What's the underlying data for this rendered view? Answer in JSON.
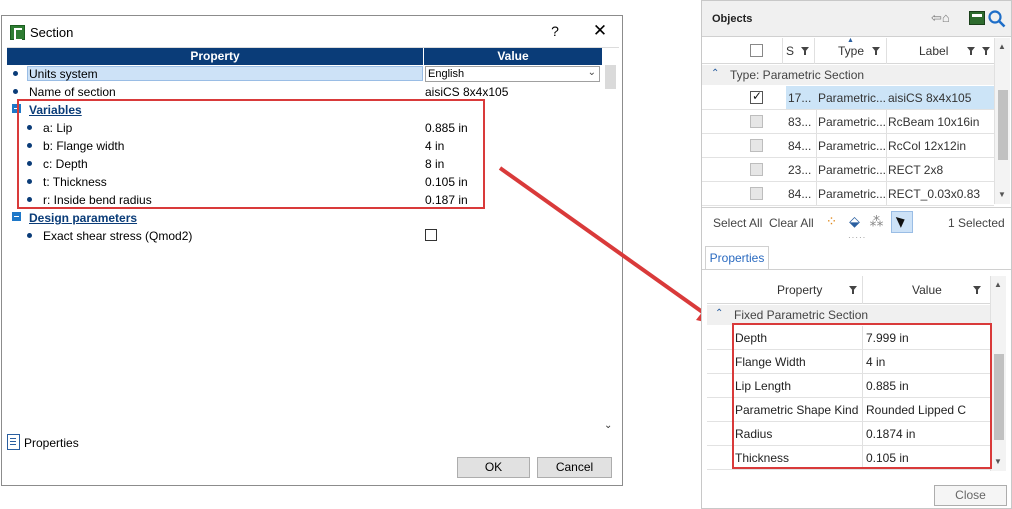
{
  "dialog": {
    "title": "Section",
    "help_glyph": "?",
    "close_glyph": "✕",
    "header_property": "Property",
    "header_value": "Value",
    "rows": {
      "units_name": "Units system",
      "units_value": "English",
      "section_name": "Name of section",
      "section_value": "aisiCS 8x4x105",
      "variables_group": "Variables",
      "lip_name": "a: Lip",
      "lip_value": "0.885 in",
      "flange_name": "b: Flange width",
      "flange_value": "4 in",
      "depth_name": "c: Depth",
      "depth_value": "8 in",
      "thickness_name": "t: Thickness",
      "thickness_value": "0.105 in",
      "radius_name": "r: Inside bend radius",
      "radius_value": "0.187 in",
      "design_group": "Design parameters",
      "shear_name": "Exact shear stress (Qmod2)"
    },
    "properties_label": "Properties",
    "ok_label": "OK",
    "cancel_label": "Cancel"
  },
  "objects": {
    "title": "Objects",
    "columns": {
      "s": "S",
      "type": "Type",
      "label": "Label"
    },
    "group_label": "Type: Parametric Section",
    "rows": [
      {
        "id": "17...",
        "type": "Parametric...",
        "label": "aisiCS 8x4x105",
        "checked": true
      },
      {
        "id": "83...",
        "type": "Parametric...",
        "label": "RcBeam 10x16in",
        "checked": false
      },
      {
        "id": "84...",
        "type": "Parametric...",
        "label": "RcCol 12x12in",
        "checked": false
      },
      {
        "id": "23...",
        "type": "Parametric...",
        "label": "RECT 2x8",
        "checked": false
      },
      {
        "id": "84...",
        "type": "Parametric...",
        "label": "RECT_0.03x0.83",
        "checked": false
      }
    ],
    "select_all": "Select All",
    "clear_all": "Clear All",
    "selected_count": "1 Selected",
    "props_tab": "Properties",
    "props_columns": {
      "property": "Property",
      "value": "Value"
    },
    "props_group": "Fixed Parametric Section",
    "props_rows": [
      {
        "key": "Depth",
        "value": "7.999 in"
      },
      {
        "key": "Flange Width",
        "value": "4 in"
      },
      {
        "key": "Lip Length",
        "value": "0.885 in"
      },
      {
        "key": "Parametric Shape Kind",
        "value": "Rounded Lipped C"
      },
      {
        "key": "Radius",
        "value": "0.1874 in"
      },
      {
        "key": "Thickness",
        "value": "0.105 in"
      }
    ],
    "close_label": "Close"
  },
  "colors": {
    "header_blue": "#0a3c78",
    "highlight_red": "#d93a3a",
    "selection_blue": "#cce4f7",
    "tab_blue": "#2a6ac0"
  },
  "icons": [
    "app-icon",
    "help-icon",
    "close-icon",
    "properties-icon",
    "back-home-icon",
    "select-tool-icon",
    "search-icon",
    "filter-icon",
    "pointer-icon"
  ]
}
